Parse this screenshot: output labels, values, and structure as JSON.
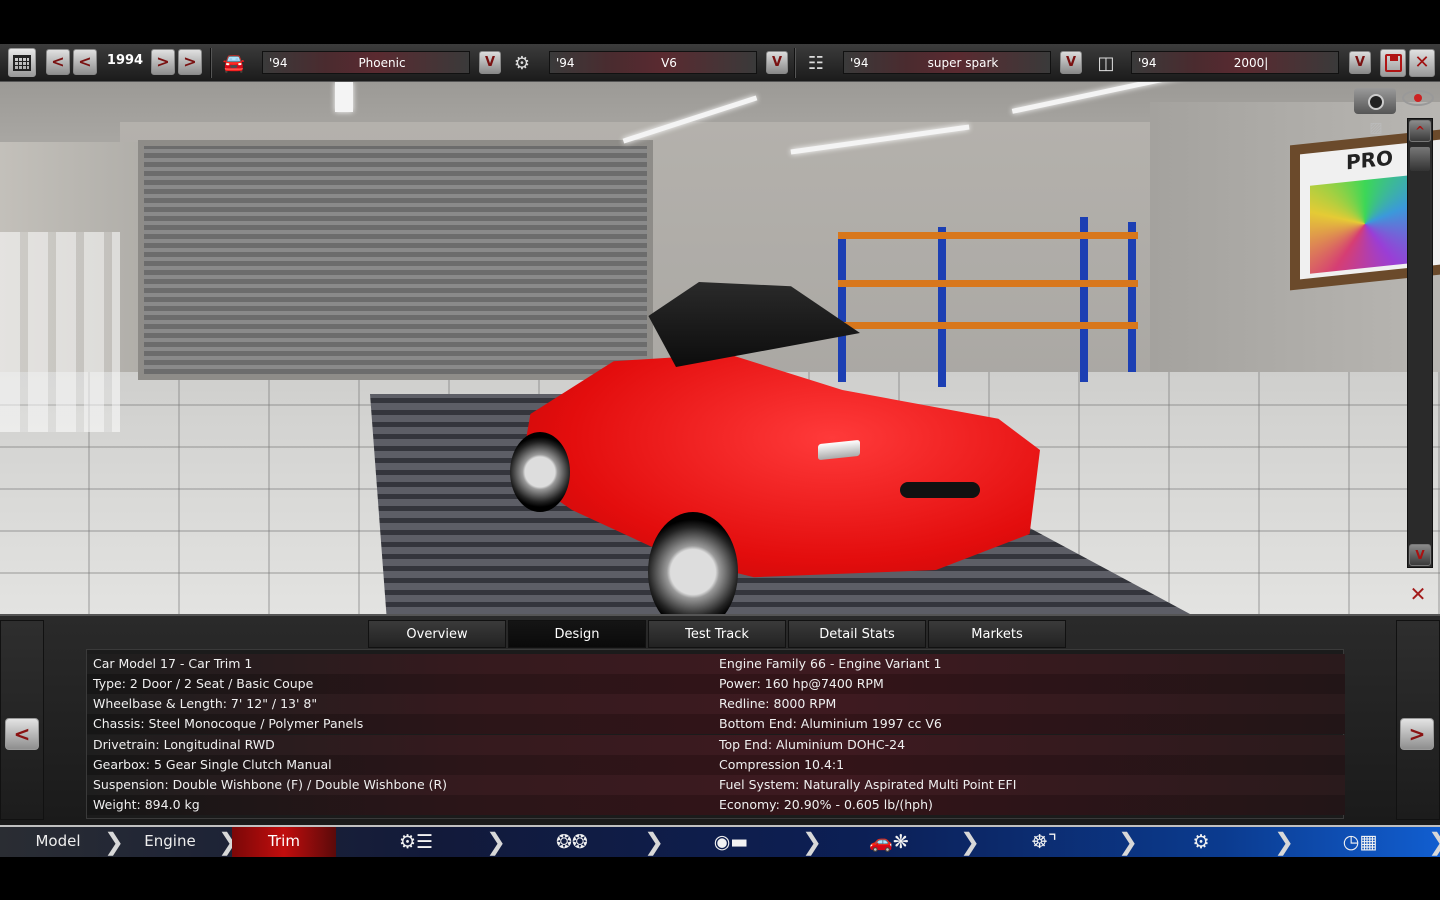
{
  "toolbar": {
    "year": "1994",
    "prev_fast": "<",
    "prev": "<",
    "next": ">",
    "next_fast": ">",
    "slots": [
      {
        "year": "'94",
        "name": "Phoenic",
        "icon": "car-model-icon"
      },
      {
        "year": "'94",
        "name": "V6",
        "icon": "engine-family-icon"
      },
      {
        "year": "'94",
        "name": "super spark",
        "icon": "engine-variant-icon"
      },
      {
        "year": "'94",
        "name": "2000|",
        "icon": "trim-icon"
      }
    ],
    "dropdown": "V"
  },
  "scene": {
    "board_text": "PRO",
    "scroll_up": "^",
    "scroll_down": "V"
  },
  "tabs": [
    "Overview",
    "Design",
    "Test Track",
    "Detail Stats",
    "Markets"
  ],
  "active_tab": "Design",
  "stats": {
    "left": [
      "Car Model 17 - Car Trim 1",
      "Type: 2 Door / 2 Seat / Basic Coupe",
      "Wheelbase & Length: 7' 12\" / 13' 8\"",
      "Chassis: Steel Monocoque / Polymer Panels",
      "Drivetrain: Longitudinal RWD",
      "Gearbox: 5 Gear Single Clutch Manual",
      "Suspension: Double Wishbone (F) / Double Wishbone (R)",
      "Weight: 894.0 kg"
    ],
    "right": [
      "Engine Family 66 - Engine Variant 1",
      "Power: 160 hp@7400 RPM",
      "Redline: 8000 RPM",
      "Bottom End: Aluminium 1997 cc V6",
      "Top End: Aluminium DOHC-24",
      "Compression 10.4:1",
      "Fuel System: Naturally Aspirated Multi Point EFI",
      "Economy: 20.90% - 0.605 lb/(hph)"
    ]
  },
  "panel_nav": {
    "prev": "<",
    "next": ">"
  },
  "bottom_nav": {
    "model": "Model",
    "engine": "Engine",
    "trim": "Trim",
    "icons": [
      "gearbox-icon",
      "wheels-icon",
      "body-icon",
      "aero-cooling-icon",
      "interior-icon",
      "suspension-icon",
      "test-icon"
    ]
  },
  "colors": {
    "accent_red": "#c10d0d",
    "car_red": "#e30d0d",
    "nav_blue": "#0b3b8f"
  }
}
